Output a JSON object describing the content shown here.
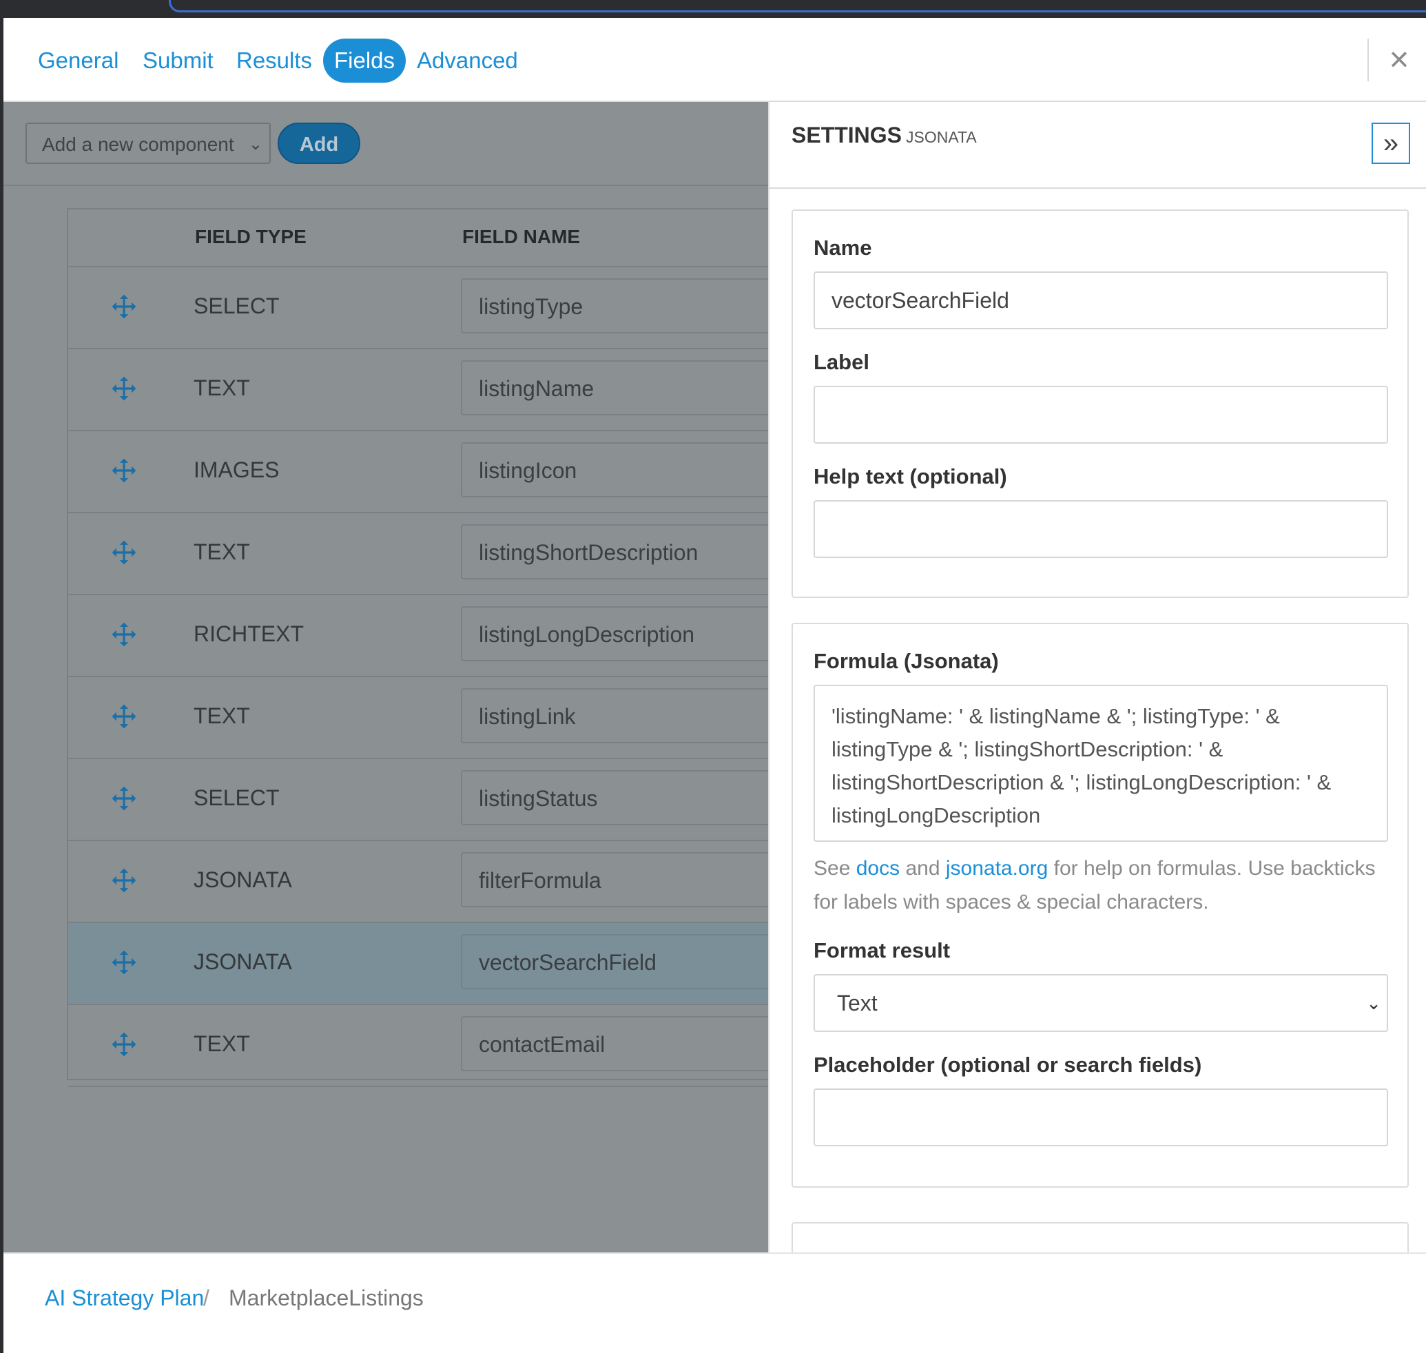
{
  "tabs": [
    {
      "label": "General",
      "active": false
    },
    {
      "label": "Submit",
      "active": false
    },
    {
      "label": "Results",
      "active": false
    },
    {
      "label": "Fields",
      "active": true
    },
    {
      "label": "Advanced",
      "active": false
    }
  ],
  "close_icon": "close-icon",
  "toolbar": {
    "component_select_value": "Add a new component",
    "add_label": "Add"
  },
  "table": {
    "headers": {
      "field_type": "FIELD TYPE",
      "field_name": "FIELD NAME"
    },
    "rows": [
      {
        "type": "SELECT",
        "name": "listingType",
        "selected": false
      },
      {
        "type": "TEXT",
        "name": "listingName",
        "selected": false
      },
      {
        "type": "IMAGES",
        "name": "listingIcon",
        "selected": false
      },
      {
        "type": "TEXT",
        "name": "listingShortDescription",
        "selected": false
      },
      {
        "type": "RICHTEXT",
        "name": "listingLongDescription",
        "selected": false
      },
      {
        "type": "TEXT",
        "name": "listingLink",
        "selected": false
      },
      {
        "type": "SELECT",
        "name": "listingStatus",
        "selected": false
      },
      {
        "type": "JSONATA",
        "name": "filterFormula",
        "selected": false
      },
      {
        "type": "JSONATA",
        "name": "vectorSearchField",
        "selected": true
      },
      {
        "type": "TEXT",
        "name": "contactEmail",
        "selected": false
      }
    ]
  },
  "settings": {
    "title": "SETTINGS",
    "subtitle": "JSONATA",
    "collapse_icon": "double-chevron-right-icon",
    "name_label": "Name",
    "name_value": "vectorSearchField",
    "label_label": "Label",
    "label_value": "",
    "help_label": "Help text (optional)",
    "help_value": "",
    "formula_label": "Formula (Jsonata)",
    "formula_value": "'listingName: ' & listingName &  '; listingType: ' & listingType & '; listingShortDescription: ' & listingShortDescription  & '; listingLongDescription: ' & listingLongDescription",
    "formula_help": {
      "prefix": "See",
      "docs_link": "docs",
      "and": "and",
      "jsonata_link": "jsonata.org",
      "suffix": "for help on formulas. Use backticks for labels with spaces & special characters."
    },
    "format_label": "Format result",
    "format_value": "Text",
    "placeholder_label": "Placeholder (optional or search fields)",
    "placeholder_value": ""
  },
  "breadcrumb": {
    "parent": "AI Strategy Plan",
    "separator": "/",
    "current": "MarketplaceListings"
  },
  "colors": {
    "accent": "#1b8fd6",
    "overlay": "#8b9193",
    "selected_row": "#7b8f99"
  }
}
